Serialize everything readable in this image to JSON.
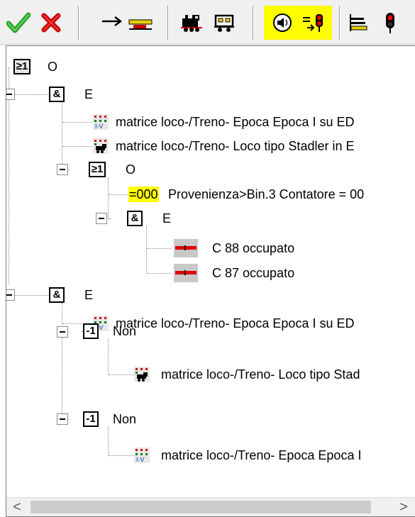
{
  "toolbar": {
    "buttons": [
      {
        "icon": "checkmark-icon",
        "color": "#2aa02a"
      },
      {
        "icon": "cross-icon",
        "color": "#cc0000"
      },
      {
        "icon": "arrow-to-track-icon"
      },
      {
        "icon": "locomotive-icon"
      },
      {
        "icon": "wagon-icon"
      },
      {
        "icon": "speaker-icon",
        "highlighted": true
      },
      {
        "icon": "signal-arrow-icon",
        "highlighted": true
      },
      {
        "icon": "track-bars-icon"
      },
      {
        "icon": "signal-light-icon"
      }
    ],
    "highlight_color": "#ffff00"
  },
  "tree": {
    "root": {
      "gate": "≥1",
      "label": "O"
    },
    "and1": {
      "gate": "&",
      "label": "E"
    },
    "and1_item1": {
      "icon": "epoch-matrix-icon",
      "label": "matrice loco-/Treno- Epoca Epoca I su ED"
    },
    "and1_item2": {
      "icon": "loco-matrix-icon",
      "label": "matrice loco-/Treno- Loco tipo Stadler in E"
    },
    "or1": {
      "gate": "≥1",
      "label": "O"
    },
    "counter": {
      "value": "=000",
      "label": "Provenienza>Bin.3 Contatore = 00"
    },
    "and2": {
      "gate": "&",
      "label": "E"
    },
    "occ1": {
      "icon": "occupied-block-icon",
      "label": "C 88 occupato"
    },
    "occ2": {
      "icon": "occupied-block-icon",
      "label": "C 87 occupato"
    },
    "and3": {
      "gate": "&",
      "label": "E"
    },
    "and3_item1": {
      "icon": "epoch-matrix-icon",
      "label": "matrice loco-/Treno- Epoca Epoca I su ED"
    },
    "not1": {
      "gate": "-1",
      "label": "Non"
    },
    "not1_item": {
      "icon": "loco-matrix-icon",
      "label": "matrice loco-/Treno- Loco tipo Stad"
    },
    "not2": {
      "gate": "-1",
      "label": "Non"
    },
    "not2_item": {
      "icon": "epoch-matrix-icon",
      "label": "matrice loco-/Treno- Epoca Epoca I"
    }
  },
  "scrollbar": {
    "left_arrow": "<",
    "right_arrow": ">"
  }
}
